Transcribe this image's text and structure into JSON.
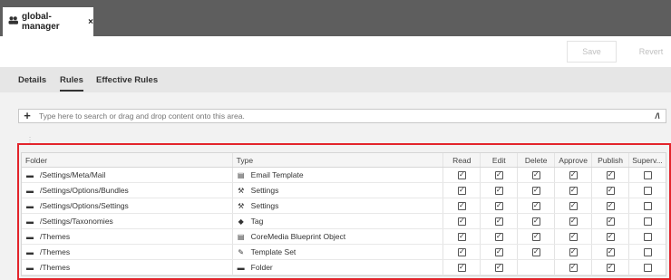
{
  "tab": {
    "title": "global-manager",
    "close": "×"
  },
  "toolbar": {
    "save_label": "Save",
    "revert_label": "Revert"
  },
  "subtabs": [
    {
      "label": "Details",
      "active": false
    },
    {
      "label": "Rules",
      "active": true
    },
    {
      "label": "Effective Rules",
      "active": false
    }
  ],
  "search": {
    "placeholder": "Type here to search or drag and drop content onto this area.",
    "library_label": "/\\"
  },
  "grid": {
    "columns": [
      "Folder",
      "Type",
      "Read",
      "Edit",
      "Delete",
      "Approve",
      "Publish",
      "Superv..."
    ],
    "rows": [
      {
        "folder": "/Settings/Meta/Mail",
        "type": "Email Template",
        "type_icon": "document-icon",
        "perms": [
          true,
          true,
          true,
          true,
          true,
          false
        ]
      },
      {
        "folder": "/Settings/Options/Bundles",
        "type": "Settings",
        "type_icon": "settings-icon",
        "perms": [
          true,
          true,
          true,
          true,
          true,
          false
        ]
      },
      {
        "folder": "/Settings/Options/Settings",
        "type": "Settings",
        "type_icon": "settings-icon",
        "perms": [
          true,
          true,
          true,
          true,
          true,
          false
        ]
      },
      {
        "folder": "/Settings/Taxonomies",
        "type": "Tag",
        "type_icon": "tag-icon",
        "perms": [
          true,
          true,
          true,
          true,
          true,
          false
        ]
      },
      {
        "folder": "/Themes",
        "type": "CoreMedia Blueprint Object",
        "type_icon": "document-icon",
        "perms": [
          true,
          true,
          true,
          true,
          true,
          false
        ]
      },
      {
        "folder": "/Themes",
        "type": "Template Set",
        "type_icon": "template-icon",
        "perms": [
          true,
          true,
          true,
          true,
          true,
          false
        ]
      },
      {
        "folder": "/Themes",
        "type": "Folder",
        "type_icon": "folder-icon",
        "perms": [
          true,
          true,
          null,
          true,
          true,
          false
        ]
      }
    ]
  },
  "colors": {
    "tabbar": "#5e5e5e",
    "subtabs": "#e6e6e6",
    "highlight": "#e3242b"
  }
}
